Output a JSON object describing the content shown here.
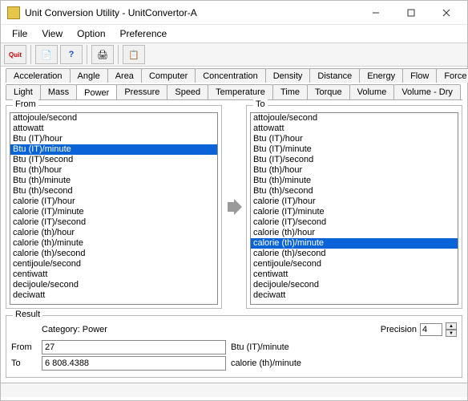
{
  "window": {
    "title": "Unit Conversion Utility - UnitConvertor-A"
  },
  "menu": {
    "file": "File",
    "view": "View",
    "option": "Option",
    "preference": "Preference"
  },
  "toolbar": {
    "quit": "Quit",
    "browse": "📄",
    "help": "?",
    "print": "🖨",
    "copy": "📋"
  },
  "tabs_row1": [
    "Acceleration",
    "Angle",
    "Area",
    "Computer",
    "Concentration",
    "Density",
    "Distance",
    "Energy",
    "Flow",
    "Force"
  ],
  "tabs_row2": [
    "Light",
    "Mass",
    "Power",
    "Pressure",
    "Speed",
    "Temperature",
    "Time",
    "Torque",
    "Volume",
    "Volume - Dry"
  ],
  "active_tab": "Power",
  "from_label": "From",
  "to_label": "To",
  "units": [
    "attojoule/second",
    "attowatt",
    "Btu (IT)/hour",
    "Btu (IT)/minute",
    "Btu (IT)/second",
    "Btu (th)/hour",
    "Btu (th)/minute",
    "Btu (th)/second",
    "calorie (IT)/hour",
    "calorie (IT)/minute",
    "calorie (IT)/second",
    "calorie (th)/hour",
    "calorie (th)/minute",
    "calorie (th)/second",
    "centijoule/second",
    "centiwatt",
    "decijoule/second",
    "deciwatt"
  ],
  "from_selected_index": 3,
  "to_selected_index": 12,
  "result": {
    "group_label": "Result",
    "category_label": "Category:",
    "category_value": "Power",
    "precision_label": "Precision",
    "precision_value": "4",
    "from_label": "From",
    "from_value": "27",
    "from_unit": "Btu (IT)/minute",
    "to_label": "To",
    "to_value": "6 808.4388",
    "to_unit": "calorie (th)/minute"
  }
}
